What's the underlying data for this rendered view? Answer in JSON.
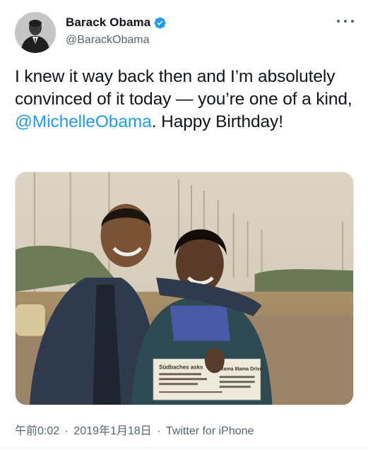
{
  "author": {
    "display_name": "Barack Obama",
    "handle": "@BarackObama",
    "verified_icon": "verified-badge-icon",
    "accent_color": "#1d9bf0"
  },
  "tweet": {
    "text_before": "I knew it way back then and I’m absolutely convinced of it today — you’re one of a kind, ",
    "mention": "@MichelleObama",
    "text_after": ". Happy Birthday!"
  },
  "photo": {
    "newspaper_left": "Südbaches  asks",
    "newspaper_right": "Mama Mama Drive"
  },
  "meta": {
    "time": "午前0:02",
    "separator": "·",
    "date": "2019年1月18日",
    "source": "Twitter for iPhone"
  },
  "colors": {
    "text_primary": "#0f1419",
    "text_secondary": "#536471",
    "link": "#1d9bf0"
  }
}
